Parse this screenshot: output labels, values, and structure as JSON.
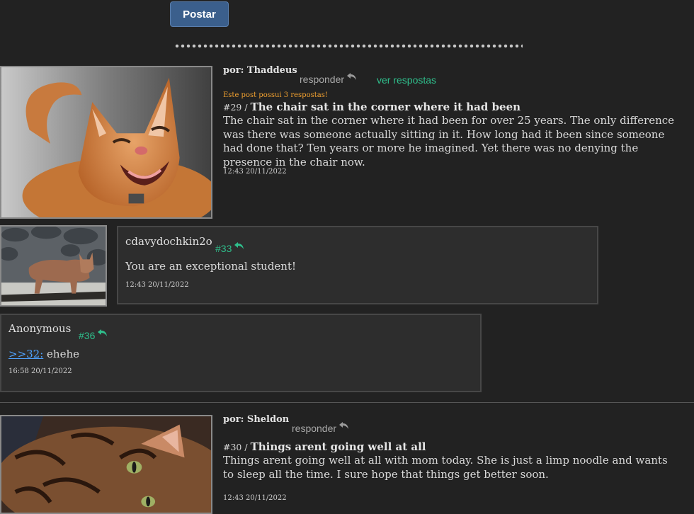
{
  "postar_label": "Postar",
  "posts": [
    {
      "author": "por: Thaddeus",
      "reply_label": "responder",
      "view_replies_label": "ver respostas",
      "notice": "Este post possui 3 respostas!",
      "number_prefix": "#29 /",
      "title": "The chair sat in the corner where it had been",
      "body": "The chair sat in the corner where it had been for over 25 years. The only difference was there was someone actually sitting in it. How long had it been since someone had done that? Ten years or more he imagined. Yet there was no denying the presence in the chair now.",
      "timestamp": "12:43 20/11/2022"
    },
    {
      "author": "por: Sheldon",
      "reply_label": "responder",
      "number_prefix": "#30 /",
      "title": "Things arent going well at all",
      "body": "Things arent going well at all with mom today. She is just a limp noodle and wants to sleep all the time. I sure hope that things get better soon.",
      "timestamp": "12:43 20/11/2022"
    }
  ],
  "replies": [
    {
      "name": "cdavydochkin2o",
      "number": "#33",
      "text": "You are an exceptional student!",
      "timestamp": "12:43 20/11/2022"
    },
    {
      "name": "Anonymous",
      "number": "#36",
      "ref": ">>32:",
      "text": " ehehe",
      "timestamp": "16:58 20/11/2022"
    }
  ]
}
